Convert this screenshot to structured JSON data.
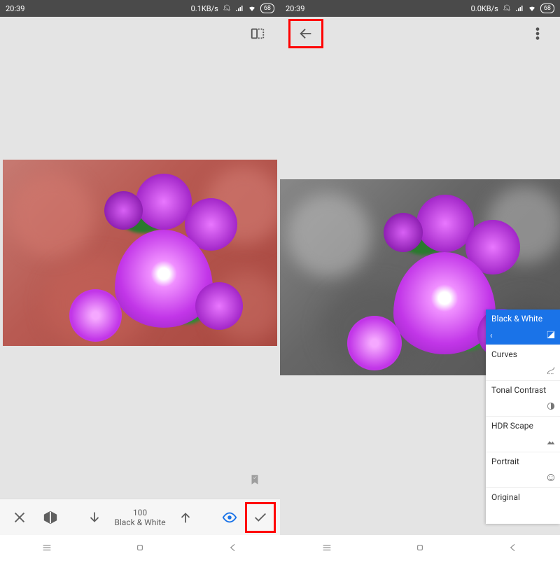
{
  "left": {
    "status": {
      "time": "20:39",
      "net": "0.1KB/s",
      "battery": "68"
    },
    "toolbar": {
      "value": "100",
      "effect_name": "Black & White"
    }
  },
  "right": {
    "status": {
      "time": "20:39",
      "net": "0.0KB/s",
      "battery": "68"
    },
    "effects": [
      {
        "label": "Black & White",
        "active": true,
        "icon": "bw"
      },
      {
        "label": "Curves",
        "icon": "curves"
      },
      {
        "label": "Tonal Contrast",
        "icon": "contrast"
      },
      {
        "label": "HDR Scape",
        "icon": "hdr"
      },
      {
        "label": "Portrait",
        "icon": "portrait"
      },
      {
        "label": "Original",
        "icon": ""
      }
    ]
  },
  "icons": {
    "compare": "compare-icon",
    "back": "back-arrow-icon",
    "overflow": "overflow-menu-icon",
    "close": "close-icon",
    "mask": "mask-layer-icon",
    "down": "arrow-down-icon",
    "up": "arrow-up-icon",
    "eye": "visibility-icon",
    "check": "check-icon",
    "recent": "nav-recent-icon",
    "home": "nav-home-icon",
    "backnav": "nav-back-icon",
    "bookmark": "bookmark-icon"
  }
}
